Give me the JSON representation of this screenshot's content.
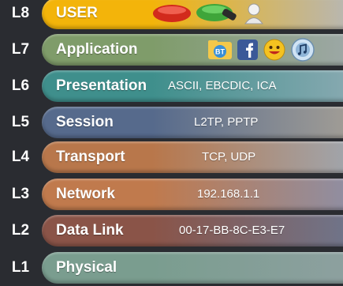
{
  "layers": [
    {
      "num": "L8",
      "name": "USER",
      "protocols": "",
      "color_from": "#f3b40a",
      "color_to": "#b5b7ba"
    },
    {
      "num": "L7",
      "name": "Application",
      "protocols": "",
      "color_from": "#7f9c6a",
      "color_to": "#9ea8a8"
    },
    {
      "num": "L6",
      "name": "Presentation",
      "protocols": "ASCII, EBCDIC, ICA",
      "color_from": "#3f8f8c",
      "color_to": "#8aaab2"
    },
    {
      "num": "L5",
      "name": "Session",
      "protocols": "L2TP, PPTP",
      "color_from": "#566a8c",
      "color_to": "#a49f96"
    },
    {
      "num": "L4",
      "name": "Transport",
      "protocols": "TCP, UDP",
      "color_from": "#b8774b",
      "color_to": "#9fa7b0"
    },
    {
      "num": "L3",
      "name": "Network",
      "protocols": "192.168.1.1",
      "color_from": "#c07a4d",
      "color_to": "#8d8fa6"
    },
    {
      "num": "L2",
      "name": "Data Link",
      "protocols": "00-17-BB-8C-E3-E7",
      "color_from": "#8a5448",
      "color_to": "#6e768d"
    },
    {
      "num": "L1",
      "name": "Physical",
      "protocols": "",
      "color_from": "#7a9d8f",
      "color_to": "#8ea0a0"
    }
  ],
  "application_icons": [
    "bittorrent-icon",
    "facebook-icon",
    "yahoo-messenger-icon",
    "itunes-icon"
  ],
  "user_icons": [
    "red-button-icon",
    "green-toggle-icon",
    "user-avatar-icon"
  ]
}
